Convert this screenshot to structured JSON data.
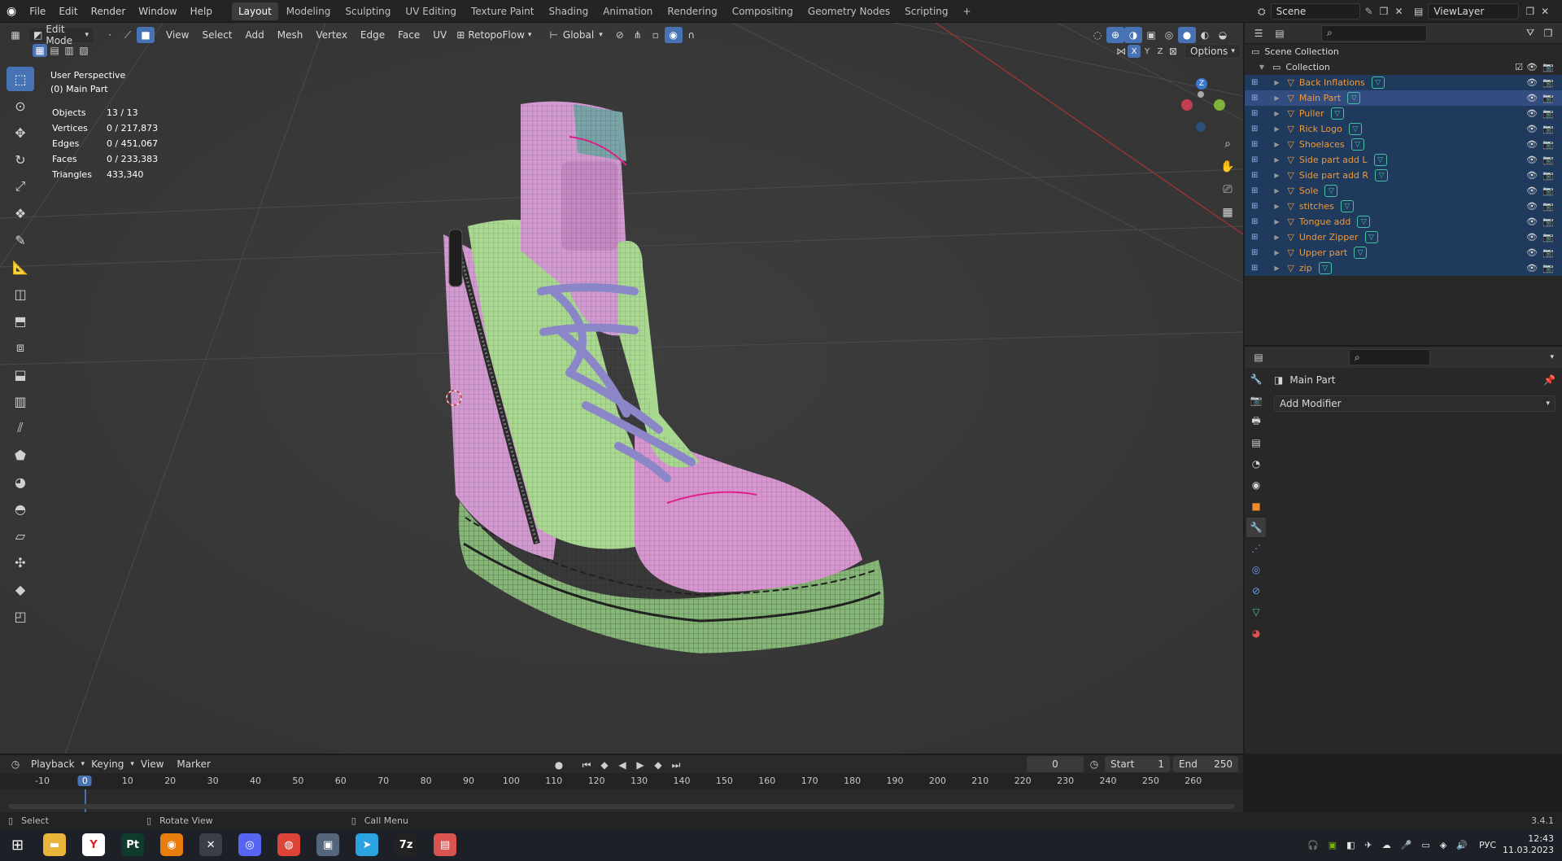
{
  "app": {
    "version": "3.4.1"
  },
  "topbar": {
    "menus": [
      "File",
      "Edit",
      "Render",
      "Window",
      "Help"
    ],
    "workspaces": [
      "Layout",
      "Modeling",
      "Sculpting",
      "UV Editing",
      "Texture Paint",
      "Shading",
      "Animation",
      "Rendering",
      "Compositing",
      "Geometry Nodes",
      "Scripting"
    ],
    "active_workspace": "Layout",
    "add_tab": "+",
    "scene_label": "Scene",
    "viewlayer_label": "ViewLayer"
  },
  "viewport_header": {
    "mode": "Edit Mode",
    "menus": [
      "View",
      "Select",
      "Add",
      "Mesh",
      "Vertex",
      "Edge",
      "Face",
      "UV"
    ],
    "addon": "RetopoFlow",
    "orientation": "Global",
    "options": "Options",
    "axes": [
      "X",
      "Y",
      "Z"
    ]
  },
  "overlay_text": {
    "view_name": "User Perspective",
    "object_name": "(0) Main Part",
    "stats": [
      {
        "label": "Objects",
        "value": "13 / 13"
      },
      {
        "label": "Vertices",
        "value": "0 / 217,873"
      },
      {
        "label": "Edges",
        "value": "0 / 451,067"
      },
      {
        "label": "Faces",
        "value": "0 / 233,383"
      },
      {
        "label": "Triangles",
        "value": "433,340"
      }
    ]
  },
  "outliner": {
    "scene_collection": "Scene Collection",
    "collection": "Collection",
    "items": [
      {
        "name": "Back Inflations",
        "state": "selected"
      },
      {
        "name": "Main Part",
        "state": "active"
      },
      {
        "name": "Puller",
        "state": "selected"
      },
      {
        "name": "Rick Logo",
        "state": "selected"
      },
      {
        "name": "Shoelaces",
        "state": "selected"
      },
      {
        "name": "Side part add L",
        "state": "selected"
      },
      {
        "name": "Side part add R",
        "state": "selected"
      },
      {
        "name": "Sole",
        "state": "selected"
      },
      {
        "name": "stitches",
        "state": "selected"
      },
      {
        "name": "Tongue add",
        "state": "selected"
      },
      {
        "name": "Under Zipper",
        "state": "selected"
      },
      {
        "name": "Upper part",
        "state": "selected"
      },
      {
        "name": "zip",
        "state": "selected"
      }
    ]
  },
  "properties": {
    "object_name": "Main Part",
    "add_modifier": "Add Modifier"
  },
  "timeline": {
    "menus": [
      "Playback",
      "Keying",
      "View",
      "Marker"
    ],
    "current_frame": "0",
    "start_label": "Start",
    "start_value": "1",
    "end_label": "End",
    "end_value": "250",
    "ticks": [
      "-10",
      "0",
      "10",
      "20",
      "30",
      "40",
      "50",
      "60",
      "70",
      "80",
      "90",
      "100",
      "110",
      "120",
      "130",
      "140",
      "150",
      "160",
      "170",
      "180",
      "190",
      "200",
      "210",
      "220",
      "230",
      "240",
      "250",
      "260"
    ],
    "playhead": "0"
  },
  "statusbar": {
    "select": "Select",
    "rotate": "Rotate View",
    "call_menu": "Call Menu",
    "version": "3.4.1"
  },
  "taskbar": {
    "apps": [
      {
        "name": "Files",
        "color": "#e8b53a",
        "glyph": "▬"
      },
      {
        "name": "Yandex",
        "color": "#ffffff",
        "glyph": "Y"
      },
      {
        "name": "Pt",
        "color": "#0e3b2c",
        "glyph": "Pt"
      },
      {
        "name": "Blender",
        "color": "#e87d0d",
        "glyph": "◉"
      },
      {
        "name": "Xbox",
        "color": "#3a3f47",
        "glyph": "✕"
      },
      {
        "name": "Discord",
        "color": "#5865f2",
        "glyph": "◎"
      },
      {
        "name": "Chrome",
        "color": "#db4437",
        "glyph": "◍"
      },
      {
        "name": "Tool",
        "color": "#55667a",
        "glyph": "▣"
      },
      {
        "name": "Telegram",
        "color": "#2aa3e0",
        "glyph": "➤"
      },
      {
        "name": "7z",
        "color": "#222222",
        "glyph": "7z"
      },
      {
        "name": "App",
        "color": "#d9534f",
        "glyph": "▤"
      }
    ],
    "lang": "РУС",
    "time": "12:43",
    "date": "11.03.2023"
  },
  "colors": {
    "accent": "#4772b3",
    "viewport_bg": "#3a3a3a",
    "outliner_selected": "#1f3a5d",
    "object_name": "#ee9a3a"
  }
}
